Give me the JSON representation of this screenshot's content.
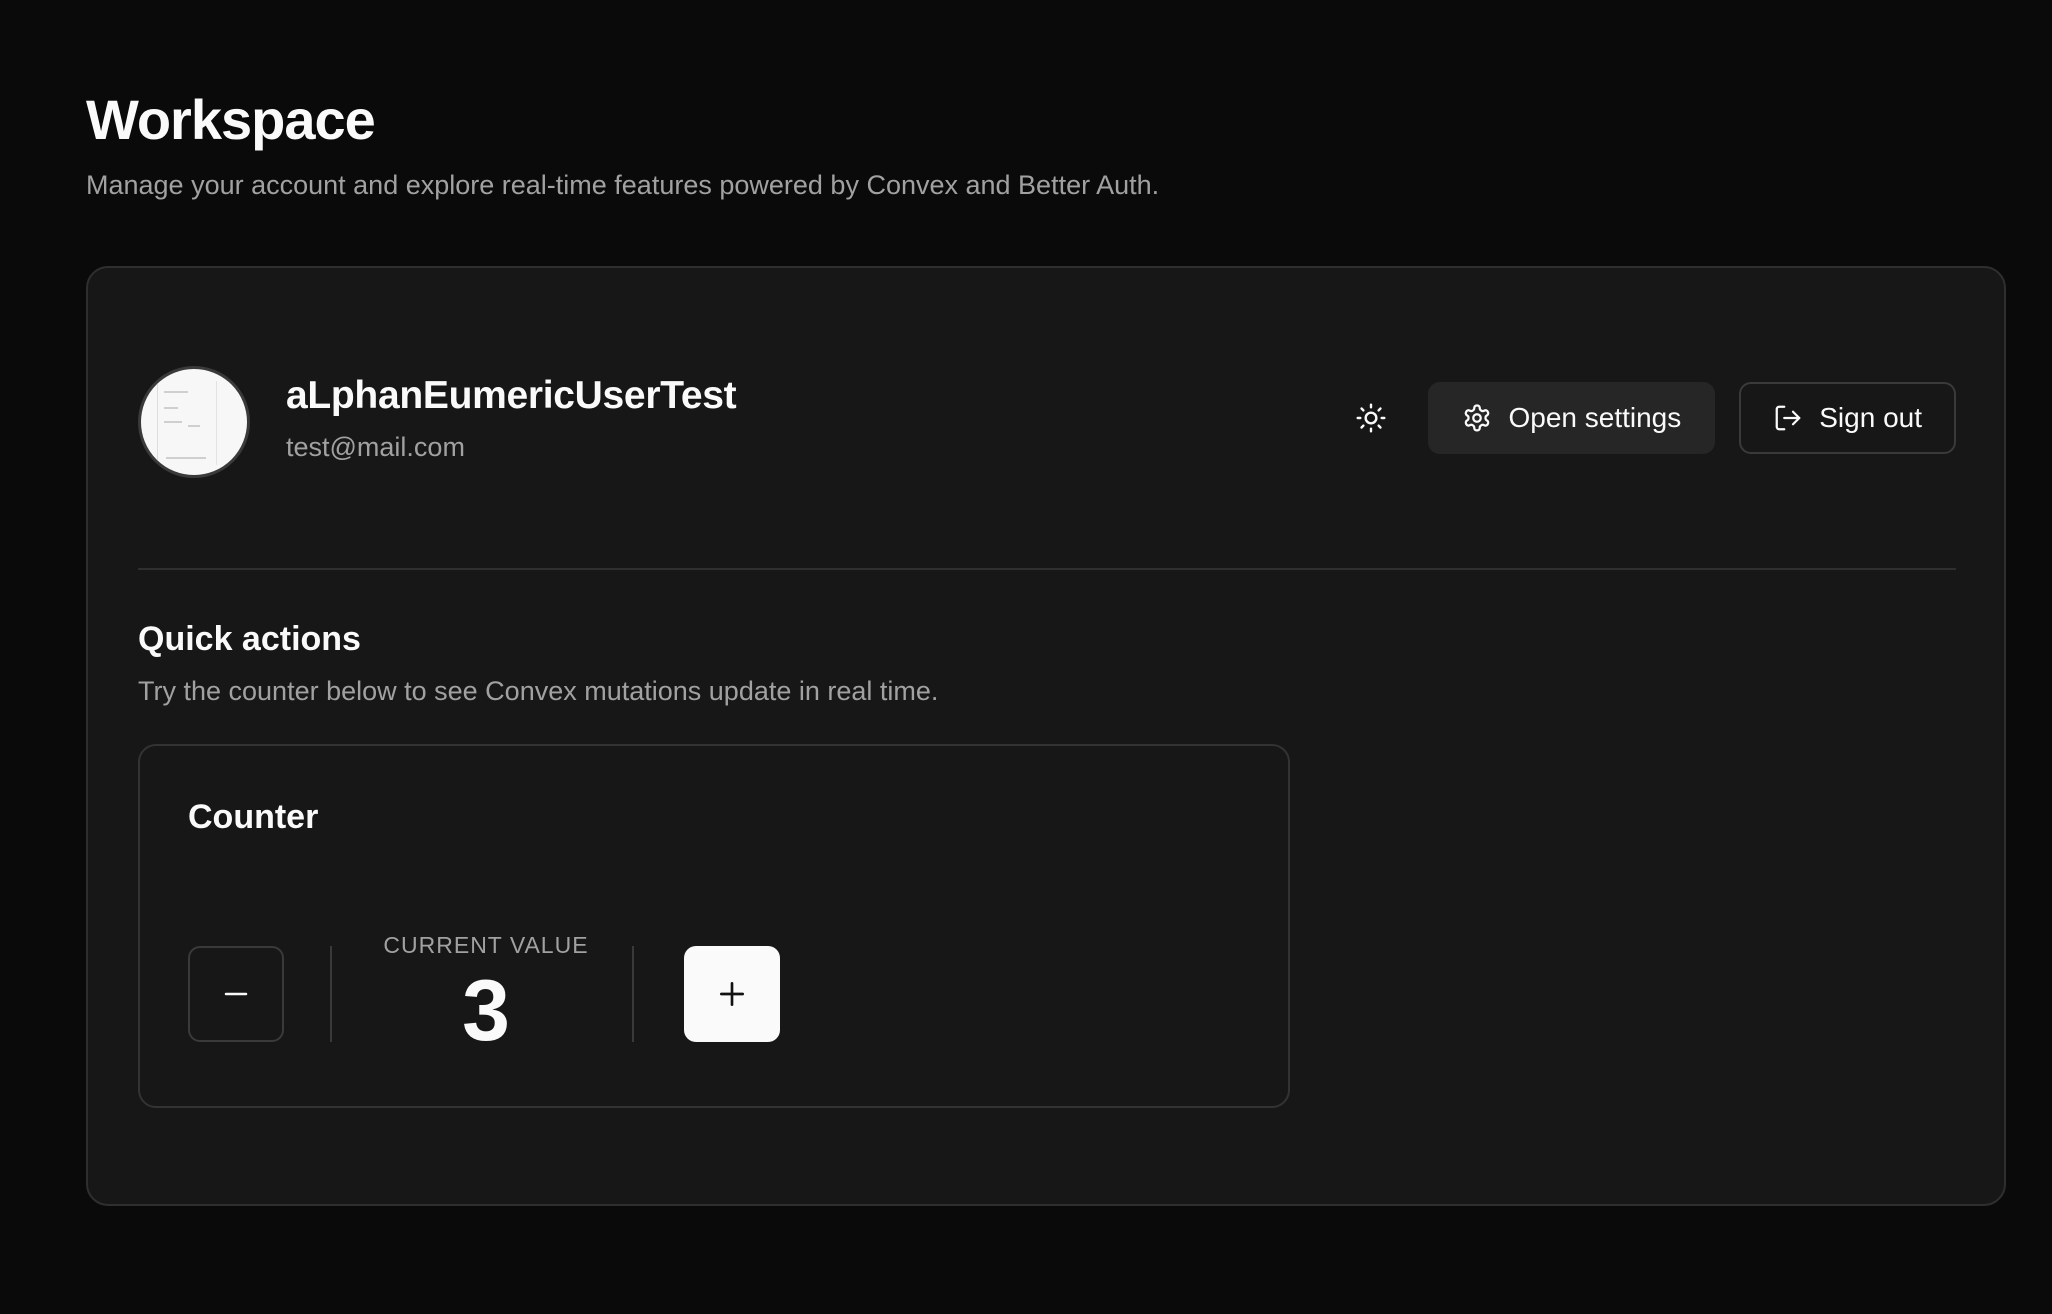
{
  "header": {
    "title": "Workspace",
    "subtitle": "Manage your account and explore real-time features powered by Convex and Better Auth."
  },
  "profile": {
    "name": "aLphanEumericUserTest",
    "email": "test@mail.com",
    "avatar_icon": "avatar-screenshot-thumbnail"
  },
  "toolbar": {
    "theme_icon": "sun-icon",
    "settings_label": "Open settings",
    "settings_icon": "gear-icon",
    "signout_label": "Sign out",
    "signout_icon": "log-out-icon"
  },
  "quick_actions": {
    "title": "Quick actions",
    "description": "Try the counter below to see Convex mutations update in real time."
  },
  "counter": {
    "title": "Counter",
    "value_label": "CURRENT VALUE",
    "value": "3",
    "decrement_icon": "minus-icon",
    "increment_icon": "plus-icon"
  },
  "colors": {
    "background": "#0a0a0a",
    "card": "#171717",
    "border": "#2f2f2f",
    "text": "#fafafa",
    "muted": "#a1a1a1"
  }
}
